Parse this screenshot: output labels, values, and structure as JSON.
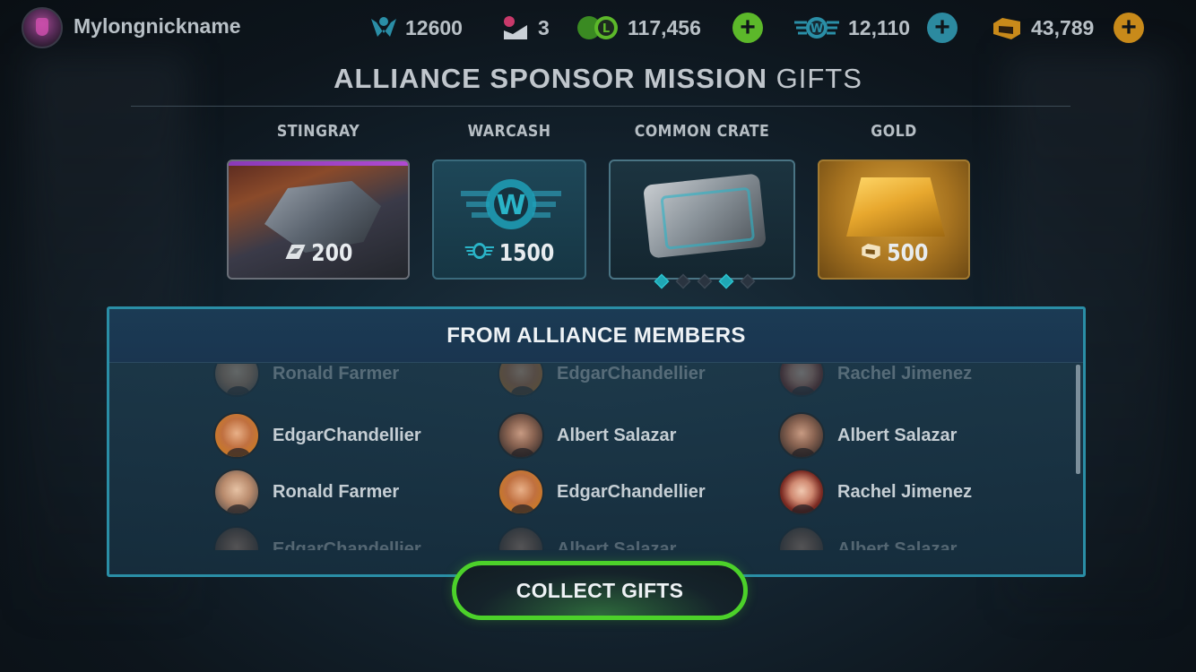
{
  "topbar": {
    "username": "Mylongnickname",
    "rank": "12600",
    "mail": "3",
    "credits": "117,456",
    "warcash": "12,110",
    "gold": "43,789",
    "plus": "+"
  },
  "title": {
    "strong": "ALLIANCE SPONSOR MISSION",
    "light": " GIFTS"
  },
  "gifts": [
    {
      "label": "STINGRAY",
      "amount": "200",
      "icon": "ship-parts-icon"
    },
    {
      "label": "WARCASH",
      "amount": "1500",
      "icon": "warcash-icon"
    },
    {
      "label": "COMMON CRATE",
      "icon": "crate-icon",
      "pager_active": [
        1,
        4
      ],
      "pager_count": 5
    },
    {
      "label": "GOLD",
      "amount": "500",
      "icon": "gold-icon"
    }
  ],
  "alliance": {
    "title": "FROM ALLIANCE MEMBERS",
    "rows": [
      [
        "Ronald Farmer",
        "EdgarChandellier",
        "Rachel Jimenez"
      ],
      [
        "EdgarChandellier",
        "Albert Salazar",
        "Albert Salazar"
      ],
      [
        "Ronald Farmer",
        "EdgarChandellier",
        "Rachel Jimenez"
      ],
      [
        "EdgarChandellier",
        "Albert Salazar",
        "Albert Salazar"
      ]
    ]
  },
  "collect_button": "COLLECT GIFTS",
  "colors": {
    "accent_teal": "#2a8ea6",
    "collect_green": "#4cd12a",
    "credits_green": "#5cb82a",
    "warcash_blue": "#2c8aa0",
    "gold": "#c88a1a"
  }
}
